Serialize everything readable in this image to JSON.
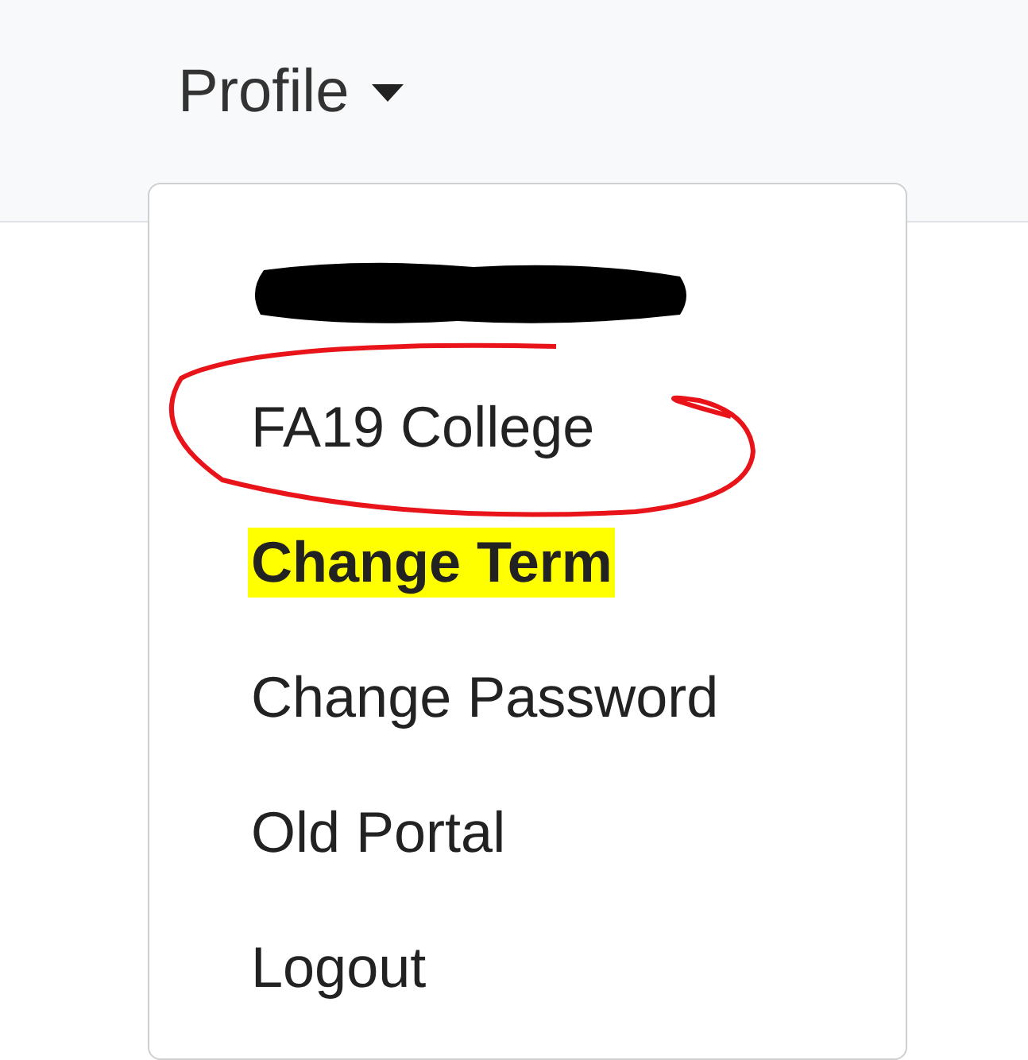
{
  "navbar": {
    "menu_label": "Profile",
    "expanded": true
  },
  "dropdown": {
    "items": [
      {
        "kind": "redacted"
      },
      {
        "kind": "link",
        "label": "FA19 College",
        "circled": true,
        "highlighted": false
      },
      {
        "kind": "link",
        "label": "Change Term",
        "circled": false,
        "highlighted": true
      },
      {
        "kind": "link",
        "label": "Change Password",
        "circled": false,
        "highlighted": false
      },
      {
        "kind": "link",
        "label": "Old Portal",
        "circled": false,
        "highlighted": false
      },
      {
        "kind": "link",
        "label": "Logout",
        "circled": false,
        "highlighted": false
      }
    ]
  }
}
